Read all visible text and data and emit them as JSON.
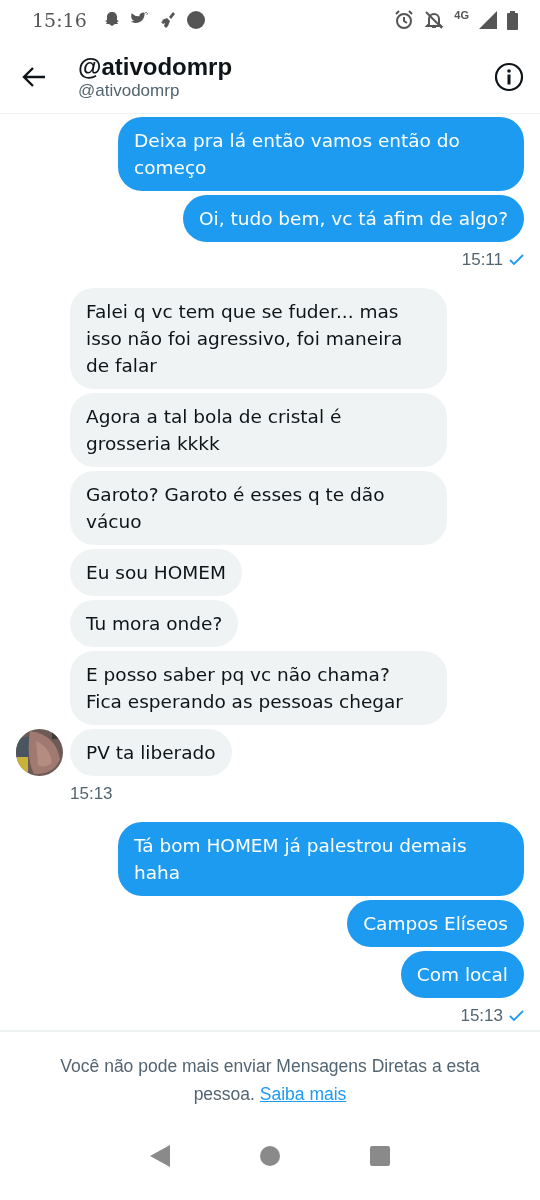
{
  "status_bar": {
    "time": "15:16",
    "network": "4G"
  },
  "header": {
    "title": "@ativodomrp",
    "subtitle": "@ativodomrp"
  },
  "groups": [
    {
      "kind": "outgoing",
      "messages": [
        "Deixa pra lá então vamos então do começo",
        "Oi, tudo bem, vc tá afim de algo?"
      ],
      "time": "15:11",
      "read": true
    },
    {
      "kind": "incoming",
      "messages": [
        "Falei q vc tem que se fuder... mas isso não foi agressivo, foi maneira de falar",
        "Agora a tal bola de cristal é grosseria kkkk",
        "Garoto? Garoto é esses q te dão vácuo",
        "Eu sou HOMEM",
        "Tu mora onde?",
        "E posso saber pq vc não chama? Fica esperando as pessoas chegar",
        "PV ta liberado"
      ],
      "time": "15:13"
    },
    {
      "kind": "outgoing",
      "messages": [
        "Tá bom HOMEM já palestrou demais haha",
        "Campos Elíseos",
        "Com local"
      ],
      "time": "15:13",
      "read": true
    }
  ],
  "footer": {
    "notice": "Você não pode mais enviar Mensagens Diretas a esta pessoa.",
    "link": "Saiba mais"
  }
}
